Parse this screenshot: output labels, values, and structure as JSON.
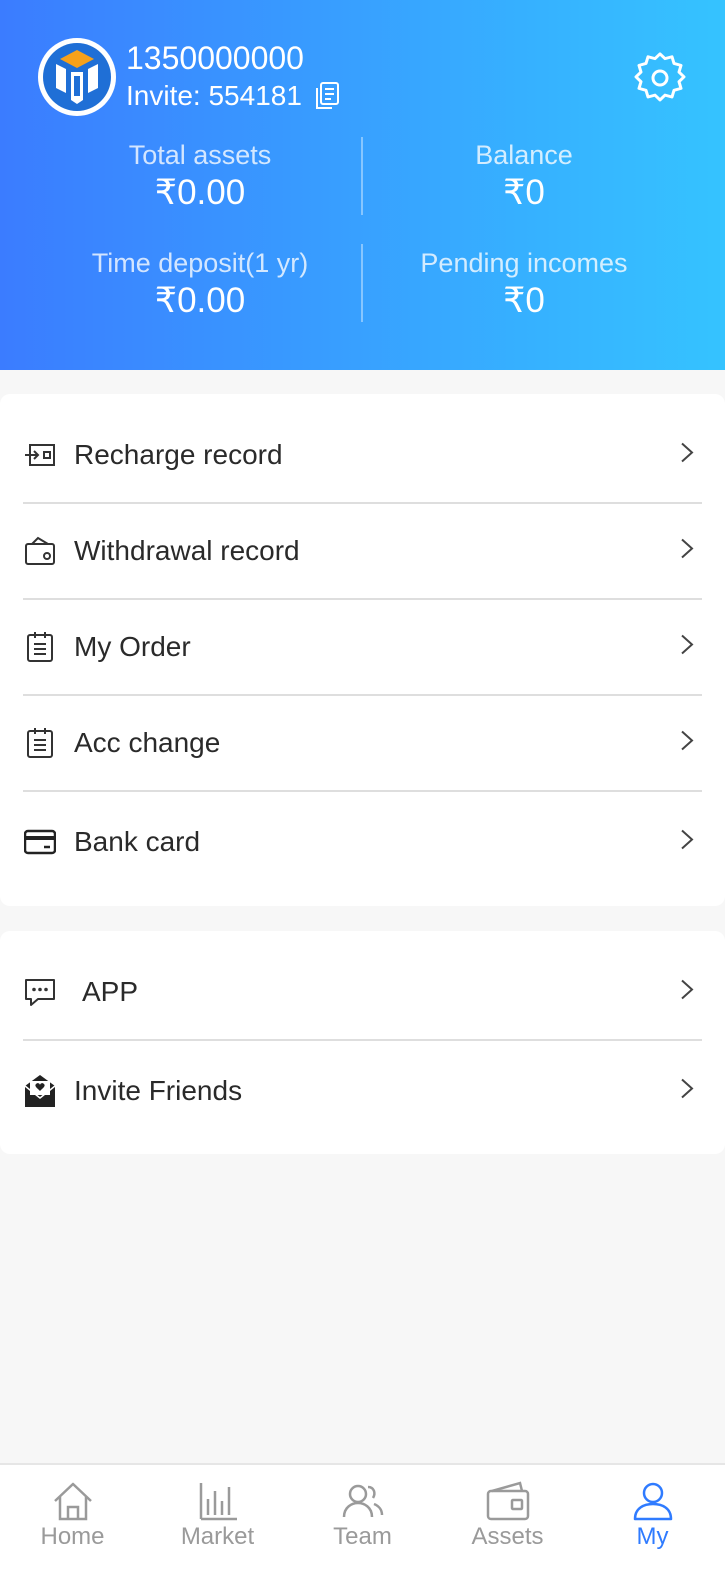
{
  "user": {
    "phone": "1350000000",
    "invite_label": "Invite: 554181"
  },
  "stats": {
    "total_assets": {
      "label": "Total assets",
      "value": "₹0.00"
    },
    "balance": {
      "label": "Balance",
      "value": "₹0"
    },
    "time_deposit": {
      "label": "Time deposit(1 yr)",
      "value": "₹0.00"
    },
    "pending_incomes": {
      "label": "Pending incomes",
      "value": "₹0"
    }
  },
  "menu_main": [
    {
      "label": "Recharge record",
      "icon": "recharge-icon"
    },
    {
      "label": "Withdrawal record",
      "icon": "wallet-icon"
    },
    {
      "label": "My Order",
      "icon": "clipboard-icon"
    },
    {
      "label": "Acc change",
      "icon": "clipboard-icon"
    },
    {
      "label": "Bank card",
      "icon": "credit-card-icon"
    }
  ],
  "menu_secondary": [
    {
      "label": "APP",
      "icon": "chat-icon"
    },
    {
      "label": "Invite Friends",
      "icon": "envelope-heart-icon"
    }
  ],
  "tabbar": {
    "active": "My",
    "active_color": "#2f7bff",
    "items": [
      {
        "label": "Home",
        "icon": "home-icon"
      },
      {
        "label": "Market",
        "icon": "bar-chart-icon"
      },
      {
        "label": "Team",
        "icon": "team-icon"
      },
      {
        "label": "Assets",
        "icon": "wallet-icon"
      },
      {
        "label": "My",
        "icon": "user-icon"
      }
    ]
  }
}
